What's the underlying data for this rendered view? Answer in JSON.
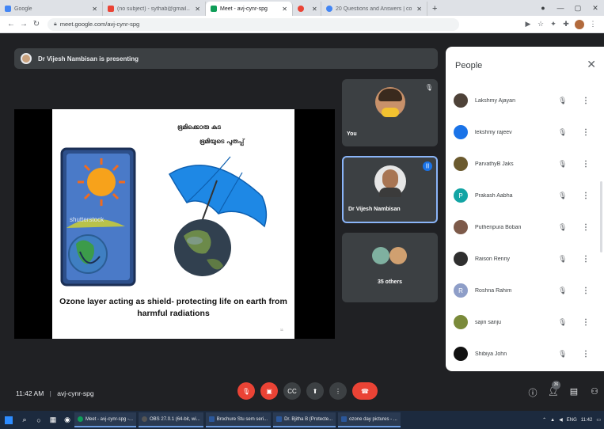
{
  "browser": {
    "tabs": [
      {
        "label": "Google",
        "active": false,
        "icon_color": "#4285f4"
      },
      {
        "label": "(no subject) - sythab@gmail...",
        "active": false,
        "icon_color": "#ea4335"
      },
      {
        "label": "Meet - avj-cynr-spg",
        "active": true,
        "icon_color": "#0f9d58"
      },
      {
        "label": "",
        "active": false,
        "icon_color": "#ea4335"
      },
      {
        "label": "20 Questions and Answers | co...",
        "active": false,
        "icon_color": "#4285f4"
      }
    ],
    "url": "meet.google.com/avj-cynr-spg"
  },
  "meet": {
    "presenting_text": "Dr Vijesh Nambisan is presenting",
    "slide": {
      "malayalam_line1": "ഭൂമിക്കൊരു കുട",
      "malayalam_line2": "ഭൂമിയുടെ പുതപ്പ്",
      "watermark": "shutterstock",
      "caption": "Ozone layer acting as shield- protecting life on earth from harmful radiations",
      "page_number": "11"
    },
    "tiles": {
      "you": "You",
      "speaker": "Dr Vijesh Nambisan",
      "others": "35 others"
    },
    "meeting_time": "11:42 AM",
    "meeting_code": "avj-cynr-spg",
    "participant_count": "36"
  },
  "people_panel": {
    "title": "People",
    "participants": [
      {
        "name": "Lakshmy Ajayan",
        "avatar_color": "#4e4238",
        "initial": ""
      },
      {
        "name": "lekshmy rajeev",
        "avatar_color": "#1a73e8",
        "initial": ""
      },
      {
        "name": "ParvathyB Jaks",
        "avatar_color": "#6b5a2e",
        "initial": ""
      },
      {
        "name": "Prakash Aabha",
        "avatar_color": "#12a4a4",
        "initial": "P"
      },
      {
        "name": "Puthenpura Boban",
        "avatar_color": "#7d5a4a",
        "initial": ""
      },
      {
        "name": "Raison Renny",
        "avatar_color": "#2f2f2f",
        "initial": ""
      },
      {
        "name": "Roshna Rahim",
        "avatar_color": "#8e9ec8",
        "initial": "R"
      },
      {
        "name": "sajin sanju",
        "avatar_color": "#7a8a3a",
        "initial": ""
      },
      {
        "name": "Shibiya John",
        "avatar_color": "#111111",
        "initial": ""
      }
    ]
  },
  "taskbar": {
    "apps": [
      {
        "label": "Meet - avj-cynr-spg -...",
        "color": "#0f9d58"
      },
      {
        "label": "OBS 27.0.1 (64-bit, wi...",
        "color": "#555555"
      },
      {
        "label": "Brochure Stu sem seri...",
        "color": "#2b579a"
      },
      {
        "label": "Dr. Bjitha B (Protecte...",
        "color": "#2b579a"
      },
      {
        "label": "ozone day pictures - ...",
        "color": "#2b579a"
      }
    ],
    "lang": "ENG",
    "clock": "11:42"
  }
}
